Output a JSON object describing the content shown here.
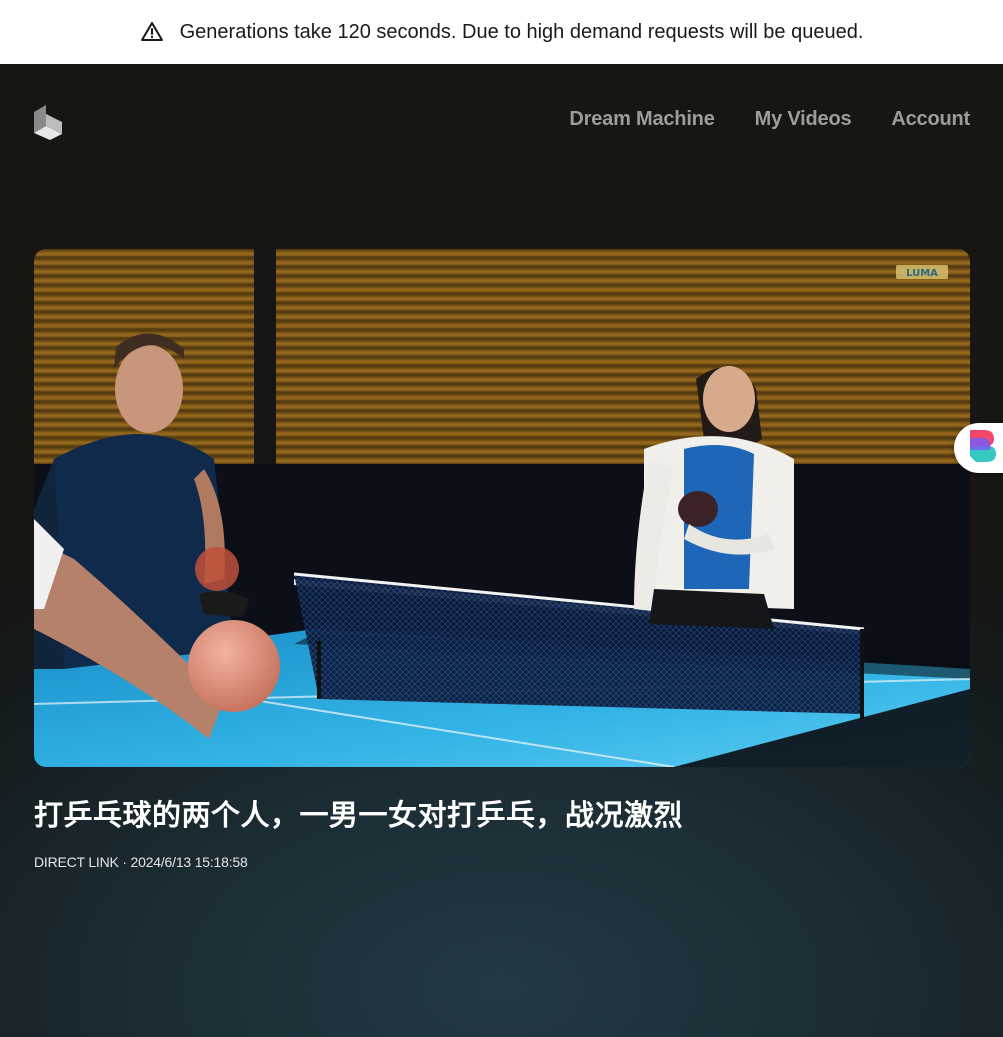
{
  "banner": {
    "icon": "warning-triangle-icon",
    "text": "Generations take 120 seconds. Due to high demand requests will be queued."
  },
  "header": {
    "logo_icon": "luma-logo-icon",
    "nav": [
      {
        "label": "Dream Machine"
      },
      {
        "label": "My Videos"
      },
      {
        "label": "Account"
      }
    ]
  },
  "video": {
    "content": "two-people-playing-table-tennis",
    "watermark": "LUMA"
  },
  "generation": {
    "title": "打乒乓球的两个人，一男一女对打乒乓，战况激烈",
    "direct_link": "DIRECT LINK",
    "separator": " · ",
    "timestamp": "2024/6/13 15:18:58"
  },
  "extension": {
    "icon": "browser-extension-icon"
  },
  "colors": {
    "nav_text": "#9c9c9c",
    "table_blue": "#2aa6d8",
    "background_dark": "#141a1b"
  }
}
